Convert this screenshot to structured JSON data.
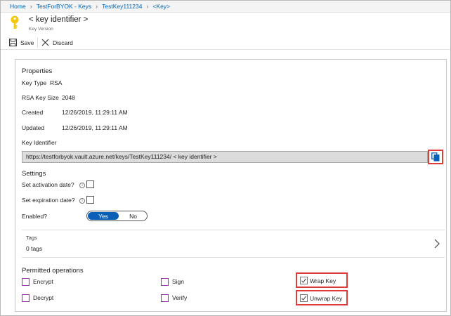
{
  "breadcrumb": [
    {
      "label": "Home"
    },
    {
      "label": "TestForBYOK - Keys"
    },
    {
      "label": "TestKey111234"
    },
    {
      "label": "<Key>"
    }
  ],
  "header": {
    "title": "< key identifier >",
    "subtitle": "Key Version",
    "icon": "key-icon",
    "icon_color": "#f2c811"
  },
  "toolbar": {
    "save_label": "Save",
    "discard_label": "Discard"
  },
  "properties": {
    "section_title": "Properties",
    "key_type_label": "Key Type",
    "key_type_value": "RSA",
    "key_size_label": "RSA Key Size",
    "key_size_value": "2048",
    "created_label": "Created",
    "created_value": "12/26/2019, 11:29:11 AM",
    "updated_label": "Updated",
    "updated_value": "12/26/2019, 11:29:11 AM",
    "key_identifier_label": "Key Identifier",
    "key_identifier_value": "https://testforbyok.vault.azure.net/keys/TestKey111234/ < key identifier >"
  },
  "settings": {
    "section_title": "Settings",
    "activation_label": "Set activation date?",
    "expiration_label": "Set expiration date?",
    "enabled_label": "Enabled?",
    "enabled_yes": "Yes",
    "enabled_no": "No",
    "enabled_selected": "Yes"
  },
  "tags": {
    "title": "Tags",
    "count_text": "0 tags"
  },
  "permitted_operations": {
    "section_title": "Permitted operations",
    "items": [
      {
        "label": "Encrypt",
        "checked": false
      },
      {
        "label": "Sign",
        "checked": false
      },
      {
        "label": "Wrap Key",
        "checked": true
      },
      {
        "label": "Decrypt",
        "checked": false
      },
      {
        "label": "Verify",
        "checked": false
      },
      {
        "label": "Unwrap Key",
        "checked": true
      }
    ]
  },
  "colors": {
    "accent": "#0a60b6",
    "link": "#0063b1",
    "highlight": "#e03b3b"
  }
}
